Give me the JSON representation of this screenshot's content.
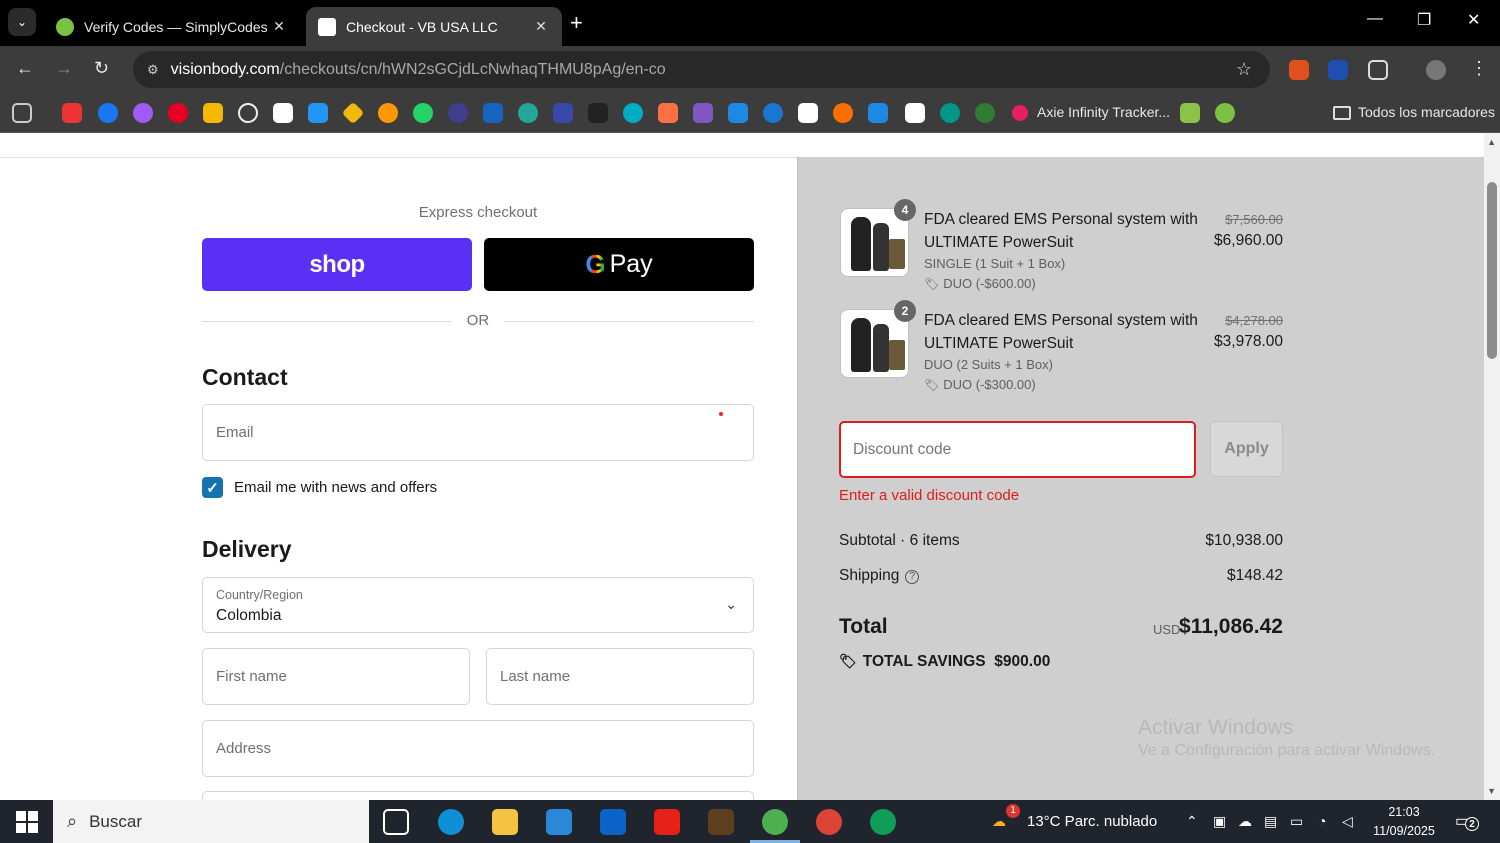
{
  "browser": {
    "tabs": [
      {
        "title": "Verify Codes — SimplyCodes",
        "active": false
      },
      {
        "title": "Checkout - VB USA LLC",
        "active": true
      }
    ],
    "url_host": "visionbody.com",
    "url_path": "/checkouts/cn/hWN2sGCjdLcNwhaqTHMU8pAg/en-co",
    "bookmarks": {
      "axie_label": "Axie Infinity Tracker...",
      "all_bookmarks_label": "Todos los marcadores"
    }
  },
  "checkout": {
    "express_label": "Express checkout",
    "shop_pay_label": "shop",
    "gpay_label": "Pay",
    "or_label": "OR",
    "contact_heading": "Contact",
    "email_placeholder": "Email",
    "newsletter_label": "Email me with news and offers",
    "newsletter_checked": true,
    "delivery_heading": "Delivery",
    "country_label": "Country/Region",
    "country_value": "Colombia",
    "first_name_placeholder": "First name",
    "last_name_placeholder": "Last name",
    "address_placeholder": "Address"
  },
  "summary": {
    "items": [
      {
        "quantity": "4",
        "title": "FDA cleared EMS Personal system with ULTIMATE PowerSuit",
        "variant": "SINGLE (1 Suit + 1 Box)",
        "discount": "DUO (-$600.00)",
        "price_original": "$7,560.00",
        "price": "$6,960.00"
      },
      {
        "quantity": "2",
        "title": "FDA cleared EMS Personal system with ULTIMATE PowerSuit",
        "variant": "DUO (2 Suits + 1 Box)",
        "discount": "DUO (-$300.00)",
        "price_original": "$4,278.00",
        "price": "$3,978.00"
      }
    ],
    "discount_placeholder": "Discount code",
    "apply_label": "Apply",
    "discount_error": "Enter a valid discount code",
    "subtotal_label": "Subtotal · 6 items",
    "subtotal_value": "$10,938.00",
    "shipping_label": "Shipping",
    "shipping_value": "$148.42",
    "total_label": "Total",
    "total_currency": "USD",
    "total_value": "$11,086.42",
    "savings_label": "TOTAL SAVINGS",
    "savings_value": "$900.00"
  },
  "watermark": {
    "line1": "Activar Windows",
    "line2": "Ve a Configuración para activar Windows."
  },
  "taskbar": {
    "search_label": "Buscar",
    "weather_badge": "1",
    "weather": "13°C  Parc. nublado",
    "time": "21:03",
    "date": "11/09/2025",
    "notifications": "2"
  },
  "colors": {
    "shop_pay": "#5a31f4",
    "error": "#dd1d1d",
    "checkbox": "#1773b0",
    "summary_bg": "#cfcfcf"
  }
}
